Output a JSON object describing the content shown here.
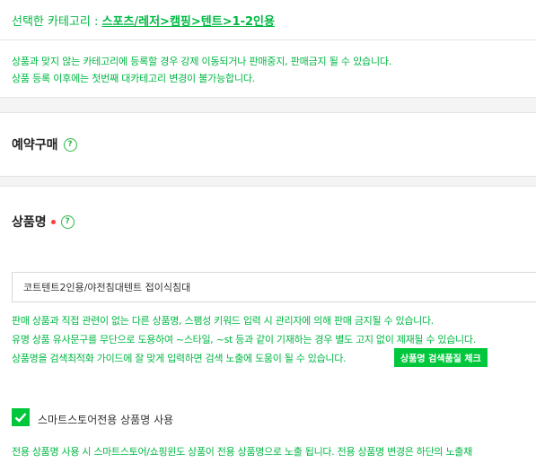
{
  "category": {
    "prefix": "선택한 카테고리 : ",
    "path": "스포츠/레저>캠핑>텐트>1-2인용"
  },
  "category_notice": [
    "상품과 맞지 않는 카테고리에 등록할 경우 강제 이동되거나 판매중지, 판매금지 될 수 있습니다.",
    "상품 등록 이후에는 첫번째 대카테고리 변경이 불가능합니다."
  ],
  "preorder": {
    "title": "예약구매",
    "help_icon": "?"
  },
  "product_name": {
    "title": "상품명",
    "help_icon": "?",
    "input_value": "코트텐트2인용/야전침대텐트 접이식침대",
    "help_lines": [
      "판매 상품과 직접 관련이 없는 다른 상품명, 스팸성 키워드 입력 시 관리자에 의해 판매 금지될 수 있습니다.",
      "유명 상품 유사문구를 무단으로 도용하여 ~스타일, ~st 등과 같이 기재하는 경우 별도 고지 없이 제재될 수 있습니다.",
      "상품명을 검색최적화 가이드에 잘 맞게 입력하면 검색 노출에 도움이 될 수 있습니다."
    ],
    "check_button": "상품명 검색품질 체크"
  },
  "smartstore": {
    "checkbox_label": "스마트스토어전용 상품명 사용",
    "checked": true,
    "notice": "전용 상품명 사용 시 스마트스토어/쇼핑윈도 상품이 전용 상품명으로 노출 됩니다. 전용 상품명 변경은 하단의 노출채"
  },
  "colors": {
    "accent": "#00c73c",
    "notice_text": "#00b843",
    "required": "#ff3c3c"
  }
}
